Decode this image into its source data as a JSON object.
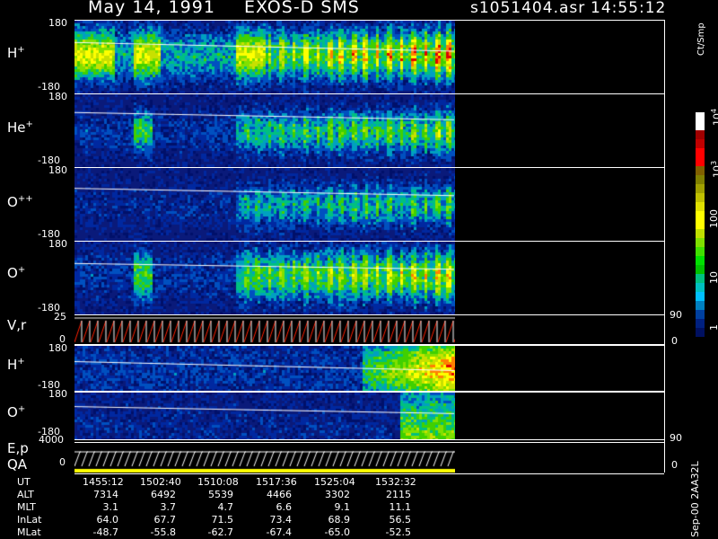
{
  "header": {
    "date": "May 14, 1991",
    "mission": "EXOS-D SMS",
    "file": "s1051404.asr",
    "time": "14:55:12"
  },
  "panels": [
    {
      "ion": "H",
      "charge": "+",
      "ymax": "180",
      "ymin": "-180"
    },
    {
      "ion": "He",
      "charge": "+",
      "ymax": "180",
      "ymin": "-180"
    },
    {
      "ion": "O",
      "charge": "++",
      "ymax": "180",
      "ymin": "-180"
    },
    {
      "ion": "O",
      "charge": "+",
      "ymax": "180",
      "ymin": "-180"
    },
    {
      "ion": "V,r",
      "charge": "",
      "ymax": "25",
      "ymin": "0",
      "right_top": "90",
      "right_bottom": "0"
    },
    {
      "ion": "H",
      "charge": "+",
      "ymax": "180",
      "ymin": "-180"
    },
    {
      "ion": "O",
      "charge": "+",
      "ymax": "180",
      "ymin": "-180"
    },
    {
      "ion": "E,p",
      "ion2": "QA",
      "charge": "",
      "ymax": "4000",
      "ymin": "0",
      "right_top": "90",
      "right_bottom": "0"
    }
  ],
  "colorbar": {
    "unit": "Ct/Smp",
    "ticks": [
      "10",
      "4",
      "10",
      "3",
      "100",
      "10",
      "1"
    ],
    "colors": [
      "#ffffff",
      "#ffffff",
      "#a00000",
      "#c00000",
      "#ff0000",
      "#ff0000",
      "#806000",
      "#808000",
      "#a0a000",
      "#c0c000",
      "#e0e000",
      "#ffff00",
      "#ffff00",
      "#c0e000",
      "#80e000",
      "#40e000",
      "#00e000",
      "#00c000",
      "#00c080",
      "#00c0c0",
      "#00c0ff",
      "#0080c0",
      "#0040a0",
      "#002080",
      "#001060"
    ]
  },
  "time_table": {
    "rows": [
      {
        "label": "UT",
        "values": [
          "1455:12",
          "1502:40",
          "1510:08",
          "1517:36",
          "1525:04",
          "1532:32"
        ]
      },
      {
        "label": "ALT",
        "values": [
          "7314",
          "6492",
          "5539",
          "4466",
          "3302",
          "2115"
        ]
      },
      {
        "label": "MLT",
        "values": [
          "3.1",
          "3.7",
          "4.7",
          "6.6",
          "9.1",
          "11.1"
        ]
      },
      {
        "label": "InLat",
        "values": [
          "64.0",
          "67.7",
          "71.5",
          "73.4",
          "68.9",
          "56.5"
        ]
      },
      {
        "label": "MLat",
        "values": [
          "-48.7",
          "-55.8",
          "-62.7",
          "-67.4",
          "-65.0",
          "-52.5"
        ]
      }
    ]
  },
  "corner_note": "Sep-00 2AA32L"
}
